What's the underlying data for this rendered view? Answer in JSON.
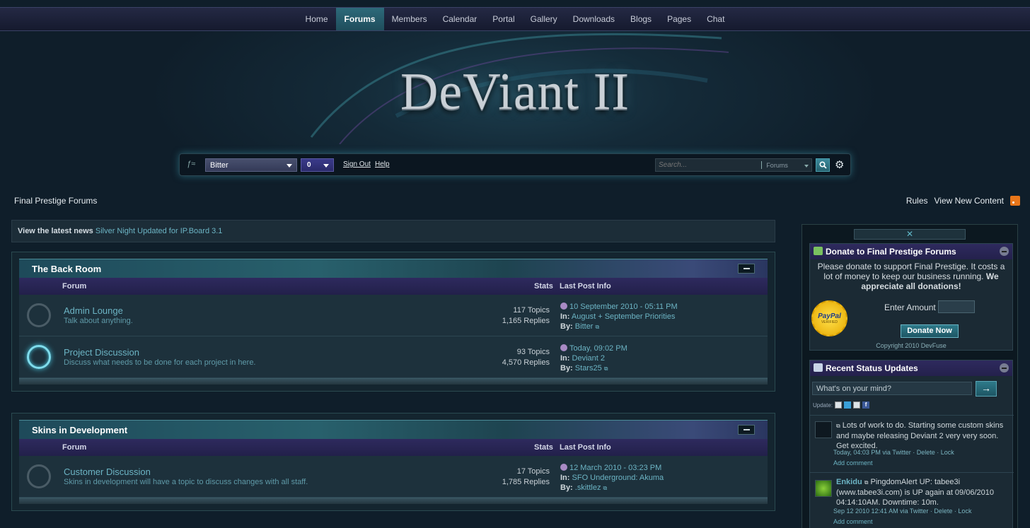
{
  "nav": {
    "items": [
      {
        "label": "Home"
      },
      {
        "label": "Forums",
        "active": true
      },
      {
        "label": "Members"
      },
      {
        "label": "Calendar"
      },
      {
        "label": "Portal"
      },
      {
        "label": "Gallery"
      },
      {
        "label": "Downloads"
      },
      {
        "label": "Blogs"
      },
      {
        "label": "Pages"
      },
      {
        "label": "Chat"
      }
    ]
  },
  "logo": {
    "text": "DeViant II"
  },
  "userbar": {
    "username": "Bitter",
    "count": "0",
    "sign_out": "Sign Out",
    "help": "Help",
    "search_placeholder": "Search...",
    "search_scope": "Forums"
  },
  "breadcrumb": "Final Prestige Forums",
  "top_links": {
    "rules": "Rules",
    "new_content": "View New Content"
  },
  "news": {
    "label": "View the latest news",
    "link": "Silver Night Updated for IP.Board 3.1"
  },
  "columns": {
    "forum": "Forum",
    "stats": "Stats",
    "last": "Last Post Info"
  },
  "categories": [
    {
      "title": "The Back Room",
      "forums": [
        {
          "name": "Admin Lounge",
          "desc": "Talk about anything.",
          "topics": "117 Topics",
          "replies": "1,165 Replies",
          "date": "10 September 2010 - 05:11 PM",
          "in_label": "In:",
          "in": "August + September Priorities",
          "by_label": "By:",
          "by": "Bitter",
          "unread": false
        },
        {
          "name": "Project Discussion",
          "desc": "Discuss what needs to be done for each project in here.",
          "topics": "93 Topics",
          "replies": "4,570 Replies",
          "date": "Today, 09:02 PM",
          "in_label": "In:",
          "in": "Deviant 2",
          "by_label": "By:",
          "by": "Stars25",
          "unread": true
        }
      ]
    },
    {
      "title": "Skins in Development",
      "forums": [
        {
          "name": "Customer Discussion",
          "desc": "Skins in development will have a topic to discuss changes with all staff.",
          "topics": "17 Topics",
          "replies": "1,785 Replies",
          "date": "12 March 2010 - 03:23 PM",
          "in_label": "In:",
          "in": "SFO Underground: Akuma",
          "by_label": "By:",
          "by": ".skittlez",
          "unread": false
        }
      ]
    }
  ],
  "sidebar": {
    "close_glyph": "✕",
    "donate": {
      "title": "Donate to Final Prestige Forums",
      "text1": "Please donate to support Final Prestige. It costs a lot of money to keep our business running.",
      "text2": "We appreciate all donations!",
      "paypal": "PayPal",
      "verified": "VERIFIED",
      "amount_label": "Enter Amount",
      "button": "Donate Now",
      "copyright": "Copyright 2010 DevFuse"
    },
    "status": {
      "title": "Recent Status Updates",
      "placeholder": "What's on your mind?",
      "go": "→",
      "update_label": "Update:",
      "fb": "f",
      "items": [
        {
          "author": "",
          "text": "Lots of work to do. Starting some custom skins and maybe releasing Deviant 2 very very soon. Get excited.",
          "meta": "Today, 04:03 PM via Twitter · Delete · Lock",
          "add": "Add comment"
        },
        {
          "author": "Enkidu",
          "text": "PingdomAlert UP: tabee3i (www.tabee3i.com) is UP again at 09/06/2010 04:14:10AM. Downtime: 10m.",
          "meta": "Sep 12 2010 12:41 AM via Twitter · Delete · Lock",
          "add": "Add comment"
        }
      ]
    }
  },
  "colors": {
    "accent": "#6cb4c4",
    "nav_active": "#2d6a7a",
    "bg": "#0f1e2a"
  }
}
